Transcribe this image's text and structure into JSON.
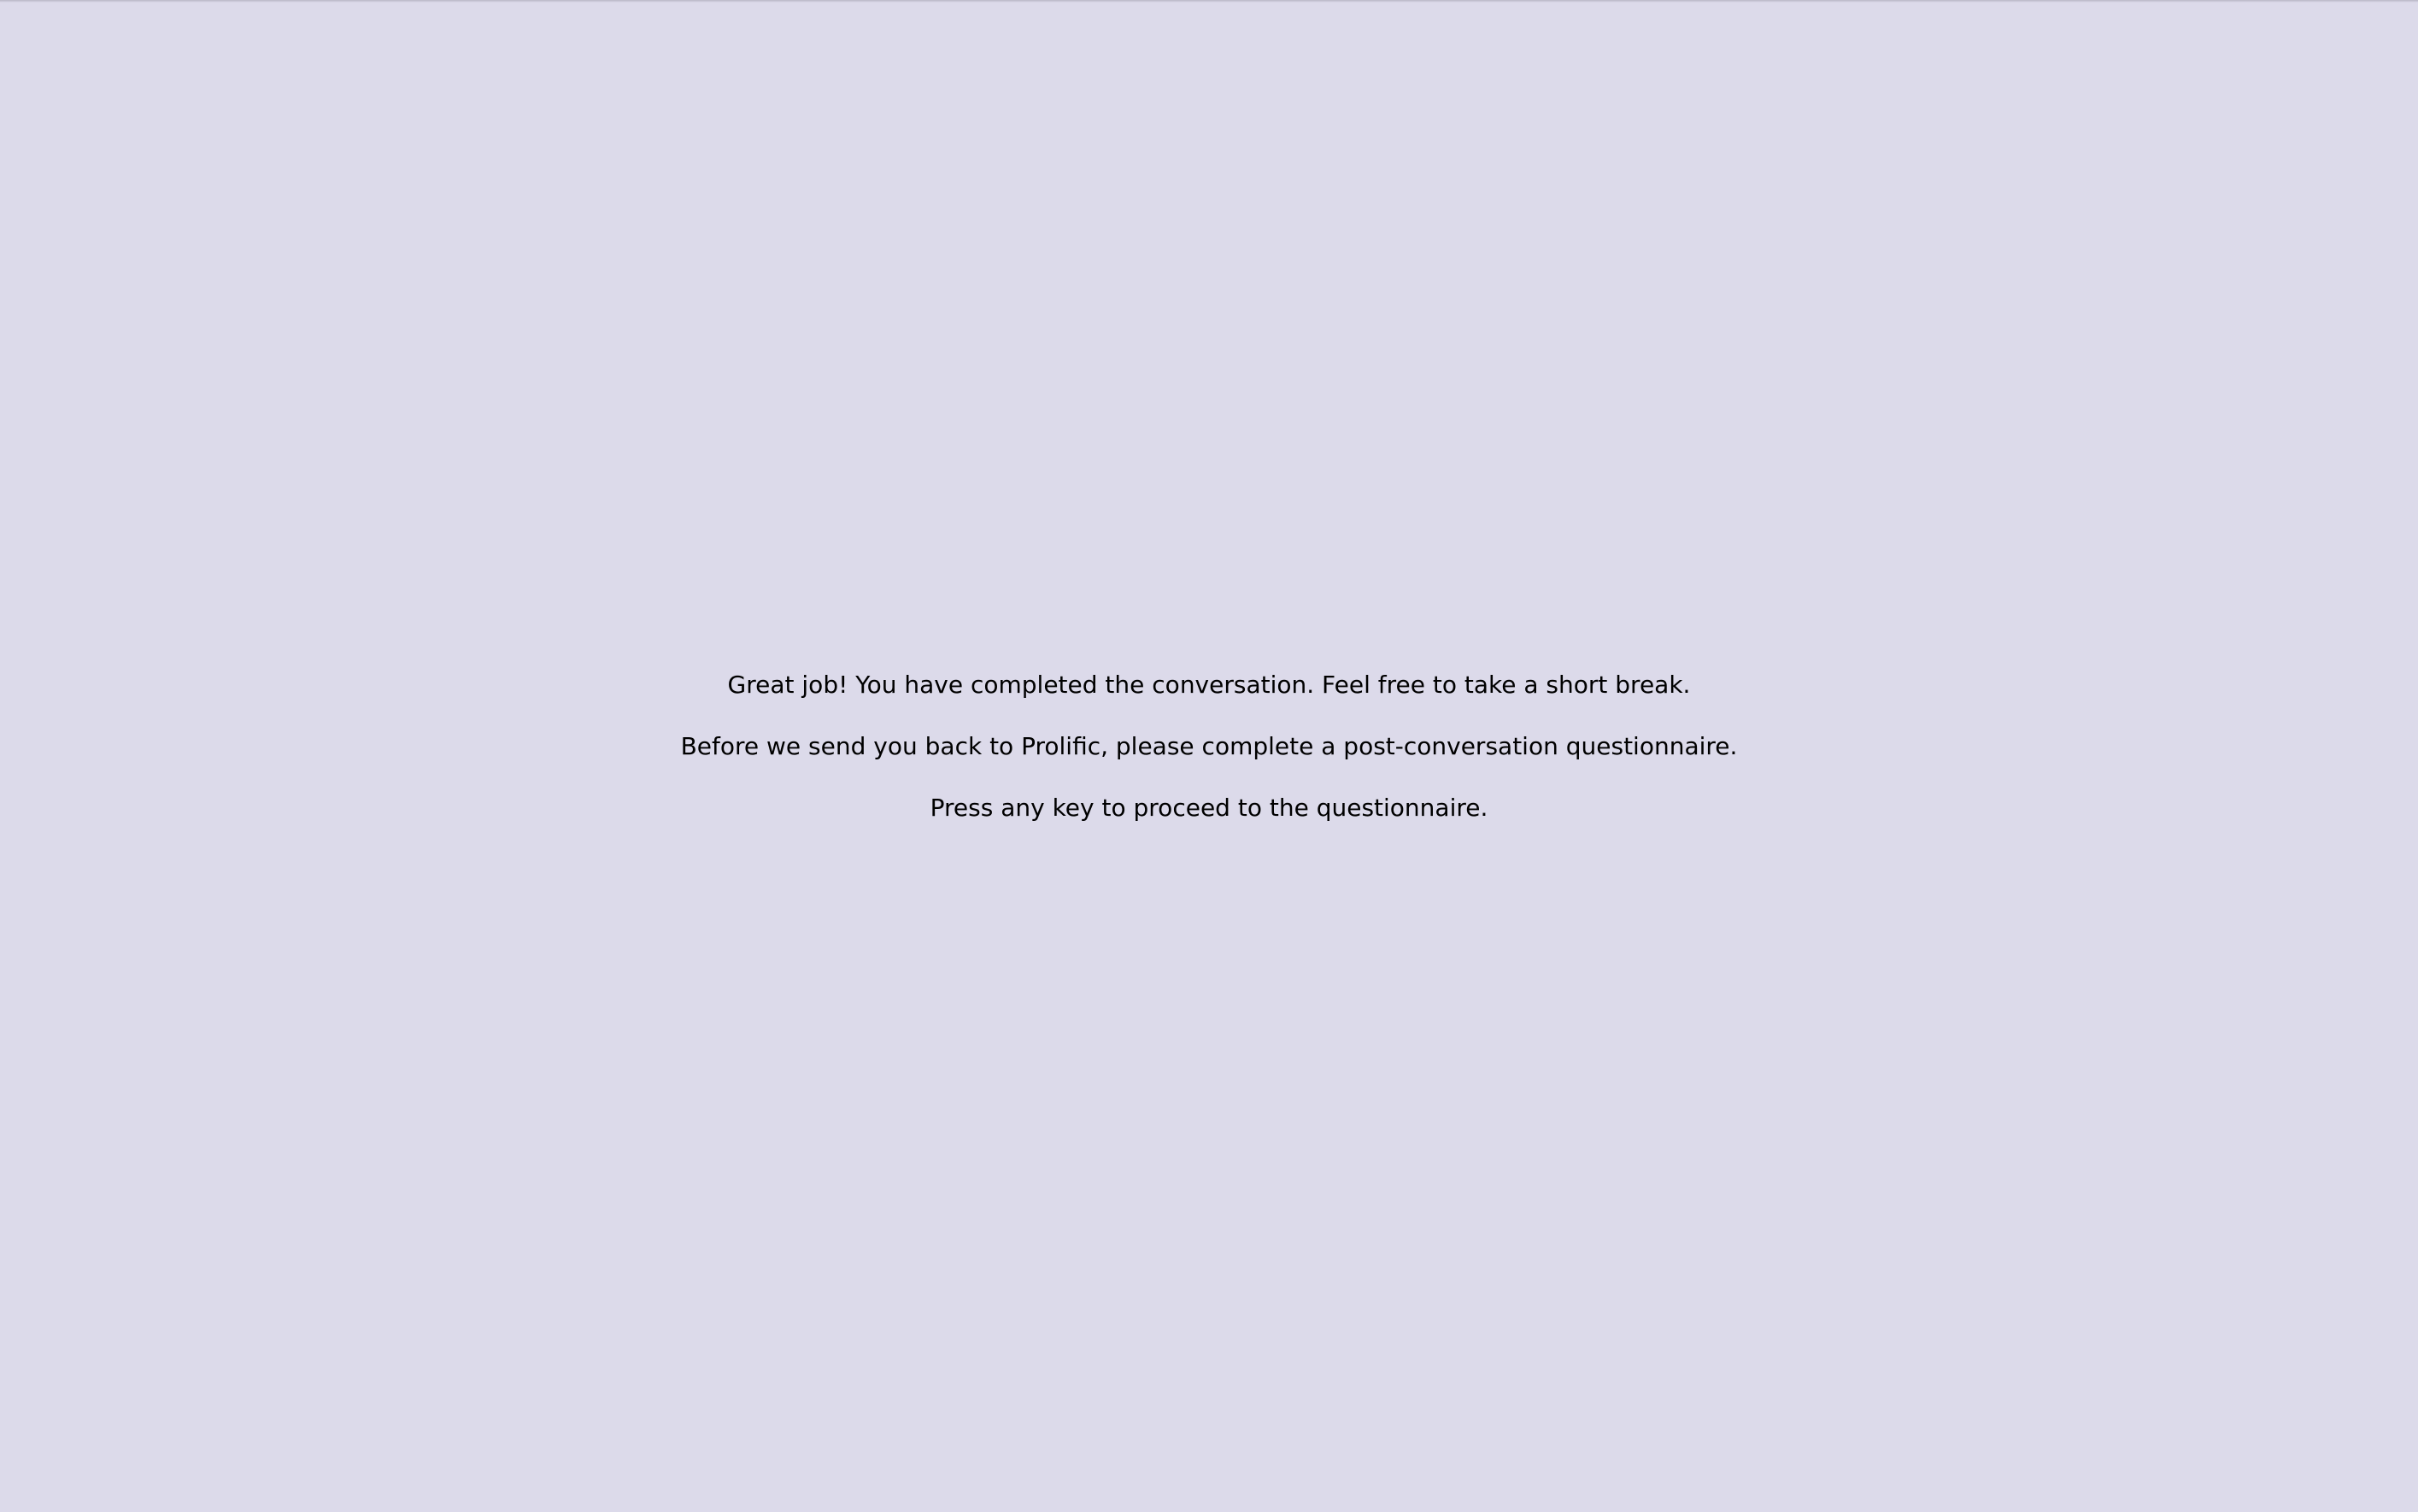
{
  "theme": {
    "background": "#dcdaea",
    "text": "#000000"
  },
  "message": {
    "line1": "Great job! You have completed the conversation. Feel free to take a short break.",
    "line2": "Before we send you back to Prolific, please complete a post-conversation questionnaire.",
    "line3": "Press any key to proceed to the questionnaire."
  }
}
